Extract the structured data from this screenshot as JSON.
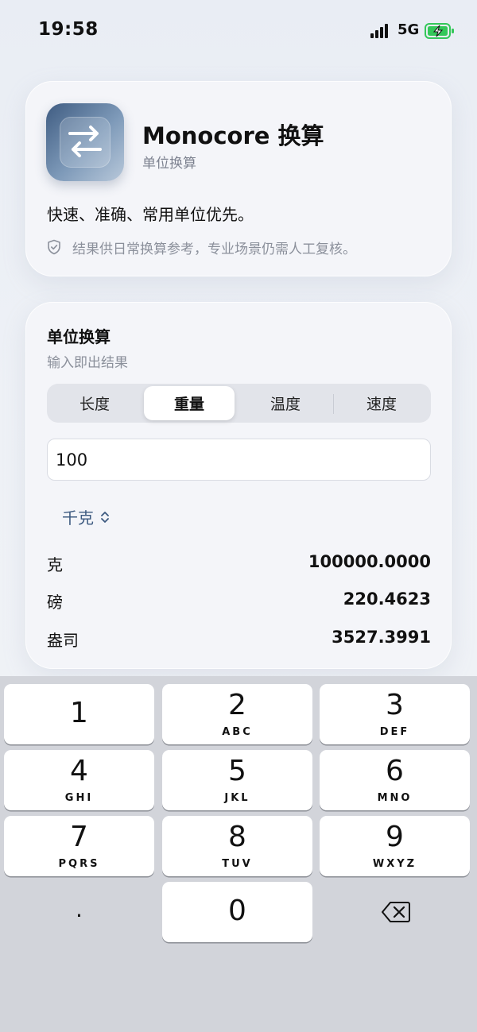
{
  "status_bar": {
    "time": "19:58",
    "network": "5G",
    "battery_color": "#34c759"
  },
  "header": {
    "app_icon": "swap-arrows-icon",
    "app_name": "Monocore 换算",
    "app_subtitle": "单位换算",
    "tagline": "快速、准确、常用单位优先。",
    "notice_icon": "shield-check-icon",
    "notice": "结果供日常换算参考，专业场景仍需人工复核。"
  },
  "converter": {
    "title": "单位换算",
    "subtitle": "输入即出结果",
    "tabs": [
      {
        "label": "长度",
        "active": false
      },
      {
        "label": "重量",
        "active": true
      },
      {
        "label": "温度",
        "active": false
      },
      {
        "label": "速度",
        "active": false
      }
    ],
    "input_value": "100",
    "source_unit": "千克",
    "results": [
      {
        "unit": "克",
        "value": "100000.0000"
      },
      {
        "unit": "磅",
        "value": "220.4623"
      },
      {
        "unit": "盎司",
        "value": "3527.3991"
      }
    ],
    "accent_color": "#3d5a80"
  },
  "keypad": {
    "keys": [
      {
        "num": "1",
        "letters": ""
      },
      {
        "num": "2",
        "letters": "ABC"
      },
      {
        "num": "3",
        "letters": "DEF"
      },
      {
        "num": "4",
        "letters": "GHI"
      },
      {
        "num": "5",
        "letters": "JKL"
      },
      {
        "num": "6",
        "letters": "MNO"
      },
      {
        "num": "7",
        "letters": "PQRS"
      },
      {
        "num": "8",
        "letters": "TUV"
      },
      {
        "num": "9",
        "letters": "WXYZ"
      },
      {
        "num": "0",
        "letters": ""
      }
    ],
    "decimal": ".",
    "delete_icon": "backspace-icon"
  }
}
